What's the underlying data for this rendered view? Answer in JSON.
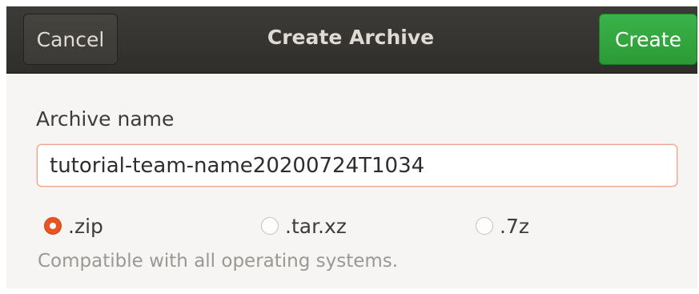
{
  "header": {
    "title": "Create Archive",
    "cancel_label": "Cancel",
    "create_label": "Create"
  },
  "form": {
    "name_label": "Archive name",
    "name_value": "tutorial-team-name20200724T1034",
    "formats": [
      {
        "label": ".zip",
        "selected": true
      },
      {
        "label": ".tar.xz",
        "selected": false
      },
      {
        "label": ".7z",
        "selected": false
      }
    ],
    "hint": "Compatible with all operating systems."
  },
  "colors": {
    "headerbar": "#3c3b37",
    "create_button": "#3bb349",
    "radio_selected": "#e95420",
    "input_focus_border": "#e9a58a"
  }
}
